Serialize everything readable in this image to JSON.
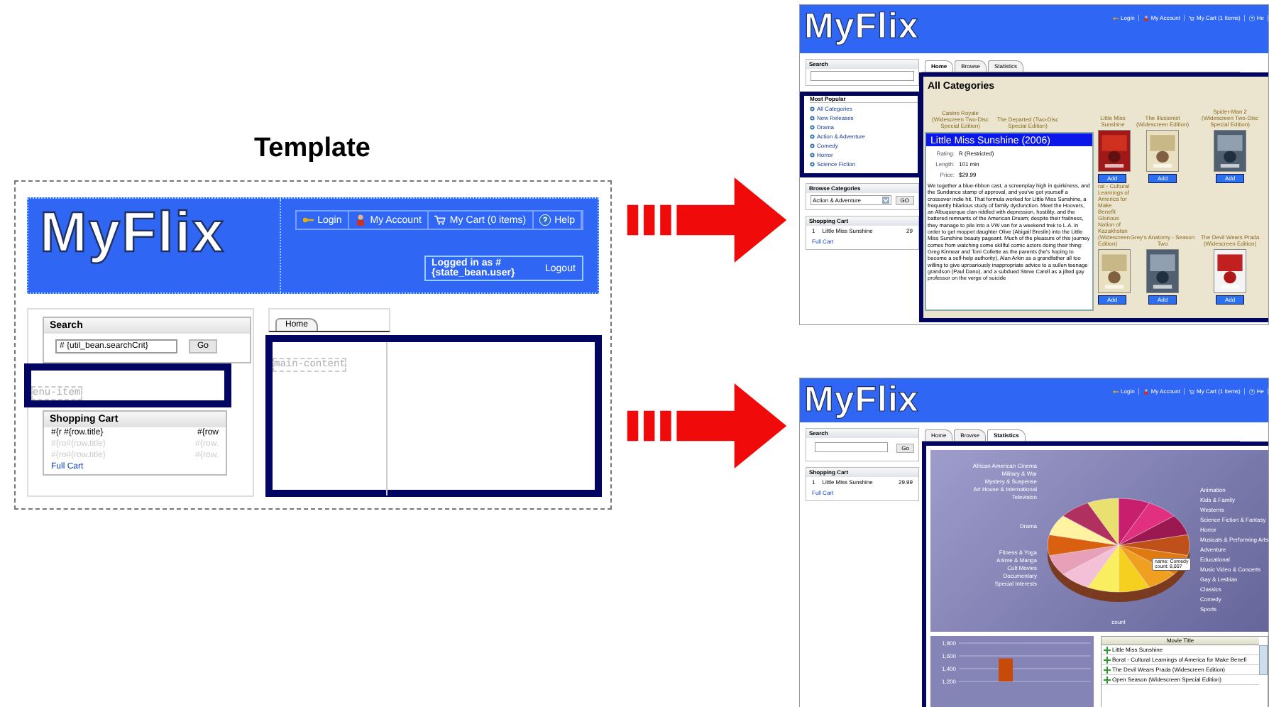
{
  "title": "Template",
  "template": {
    "logo": "MyFlix",
    "nav": [
      {
        "label": "Login"
      },
      {
        "label": "My Account"
      },
      {
        "label": "My Cart (0 items)"
      },
      {
        "label": "Help"
      }
    ],
    "logged_in": "Logged in as #{state_bean.user}",
    "logout": "Logout",
    "search": {
      "title": "Search",
      "value": "# {util_bean.searchCrit}",
      "button": "Go"
    },
    "menu_placeholder": "enu-item",
    "cart": {
      "title": "Shopping Cart",
      "rows": [
        {
          "title": "#{r #{row.title}",
          "price": "#{row",
          "disabled": false
        },
        {
          "title": "#{ro#{row.title}",
          "price": "#{row.",
          "disabled": true
        },
        {
          "title": "#{ro#{row.title}",
          "price": "#{row.",
          "disabled": true
        }
      ],
      "link": "Full Cart"
    },
    "tabs": [
      {
        "label": "Home",
        "selected": true
      }
    ],
    "main_placeholder": "main-content"
  },
  "home_screen": {
    "logo": "MyFlix",
    "nav": [
      {
        "label": "Login"
      },
      {
        "label": "My Account"
      },
      {
        "label": "My Cart (1 Items)"
      },
      {
        "label": "He"
      }
    ],
    "search": {
      "title": "Search"
    },
    "popular": {
      "title": "Most Popular",
      "items": [
        "All Categories",
        "New Releases",
        "Drama",
        "Action & Adventure",
        "Comedy",
        "Horror",
        "Science Fiction"
      ]
    },
    "browse": {
      "title": "Browse Categories",
      "value": "Action & Adventure",
      "button": "GO"
    },
    "cart": {
      "title": "Shopping Cart",
      "rows": [
        {
          "qty": "1",
          "title": "Little Miss Sunshine",
          "price": "29"
        }
      ],
      "link": "Full Cart"
    },
    "tabs": [
      {
        "label": "Home",
        "selected": true
      },
      {
        "label": "Browse",
        "selected": false
      },
      {
        "label": "Statistics",
        "selected": false
      }
    ],
    "heading": "All Categories",
    "movie_rows": [
      [
        {
          "title": "Casino Royale (Widescreen Two-Disc Special Edition)",
          "poster": false
        },
        {
          "title": "The Departed (Two-Disc Special Edition)",
          "poster": false
        },
        {
          "title": "Little Miss Sunshine",
          "poster": true,
          "button": "Add"
        },
        {
          "title": "The Illusionist (Widescreen Edition)",
          "poster": true,
          "button": "Add"
        },
        {
          "title": "Spider-Man 2 (Widescreen Two-Disc Special Edition)",
          "poster": true,
          "button": "Add"
        }
      ],
      [
        {
          "title": "rat - Cultural Learnings of America for Make Benefit Glorious Nation of Kazakhstan (Widescreen Edition)",
          "poster": true,
          "button": "Add"
        },
        {
          "title": "Grey's Anatomy - Season Two",
          "poster": true,
          "button": "Add"
        },
        {
          "title": "The Devil Wears Prada (Widescreen Edition)",
          "poster": true,
          "button": "Add"
        }
      ]
    ],
    "popup": {
      "title": "Little Miss Sunshine (2006)",
      "fields": [
        {
          "label": "Rating:",
          "value": "R (Restricted)"
        },
        {
          "label": "Length:",
          "value": "101 min"
        },
        {
          "label": "Price:",
          "value": "$29.99"
        }
      ],
      "description": "We together a blue-ribbon cast, a screenplay high in quirkiness, and the Sundance stamp of approval, and you've got yourself a crossover indie hit. That formula worked for Little Miss Sunshine, a frequently hilarious study of family dysfunction. Meet the Hoovers, an Albuquerque clan riddled with depression, hostility, and the battered remnants of the American Dream; despite their frailness, they manage to pile into a VW van for a weekend trek to L.A. in order to get moppet daughter Olive (Abigail Breslin) into the Little Miss Sunshine beauty pageant. Much of the pleasure of this journey comes from watching some skillful comic actors doing their thing: Greg Kinnear and Toni Collette as the parents (he's hoping to become a self-help authority), Alan Arkin as a grandfather all too willing to give uproariously inappropriate advice to a sullen teenage grandson (Paul Dano), and a subdued Steve Carell as a jilted gay professor on the verge of suicide"
    }
  },
  "stats_screen": {
    "logo": "MyFlix",
    "nav": [
      {
        "label": "Login"
      },
      {
        "label": "My Account"
      },
      {
        "label": "My Cart (1 Items)"
      },
      {
        "label": "He"
      }
    ],
    "search": {
      "title": "Search",
      "button": "Go"
    },
    "cart": {
      "title": "Shopping Cart",
      "rows": [
        {
          "qty": "1",
          "title": "Little Miss Sunshine",
          "price": "29.99"
        }
      ],
      "link": "Full Cart"
    },
    "tabs": [
      {
        "label": "Home",
        "selected": false
      },
      {
        "label": "Browse",
        "selected": false
      },
      {
        "label": "Statistics",
        "selected": true
      }
    ],
    "pie_labels_left": [
      "African American Cinema",
      "Military & War",
      "Mystery & Suspense",
      "Art House & International",
      "Television",
      "Drama",
      "Fitness & Yoga",
      "Anime & Manga",
      "Cult Movies",
      "Documentary",
      "Special Interests"
    ],
    "pie_labels_right": [
      "Animation",
      "Kids & Family",
      "Westerns",
      "Science Fiction & Fantasy",
      "Horror",
      "Musicals & Performing Arts",
      "Adventure",
      "Educational",
      "Music Video & Concerts",
      "Gay & Lesbian",
      "Classics",
      "Comedy",
      "Sports"
    ],
    "tooltip": [
      "name: Comedy",
      "count: 8,007"
    ],
    "axis_label": "count",
    "bar_chart": {
      "chart_data": {
        "type": "bar",
        "grid": true,
        "ylim": [
          1200,
          1800
        ],
        "values": [
          null,
          1560,
          null
        ],
        "yticks": [
          {
            "value": 1800,
            "label": "1,800"
          },
          {
            "value": 1600,
            "label": "1,600"
          },
          {
            "value": 1400,
            "label": "1,400"
          },
          {
            "value": 1200,
            "label": "1,200"
          }
        ]
      }
    },
    "table": {
      "column": "Movie Title",
      "rows": [
        "Little Miss Sunshine",
        "Borat - Cultural Learnings of America for Make Benefi",
        "The Devil Wears Prada (Widescreen Edition)",
        "Open Season (Widescreen Special Edition)"
      ]
    }
  }
}
